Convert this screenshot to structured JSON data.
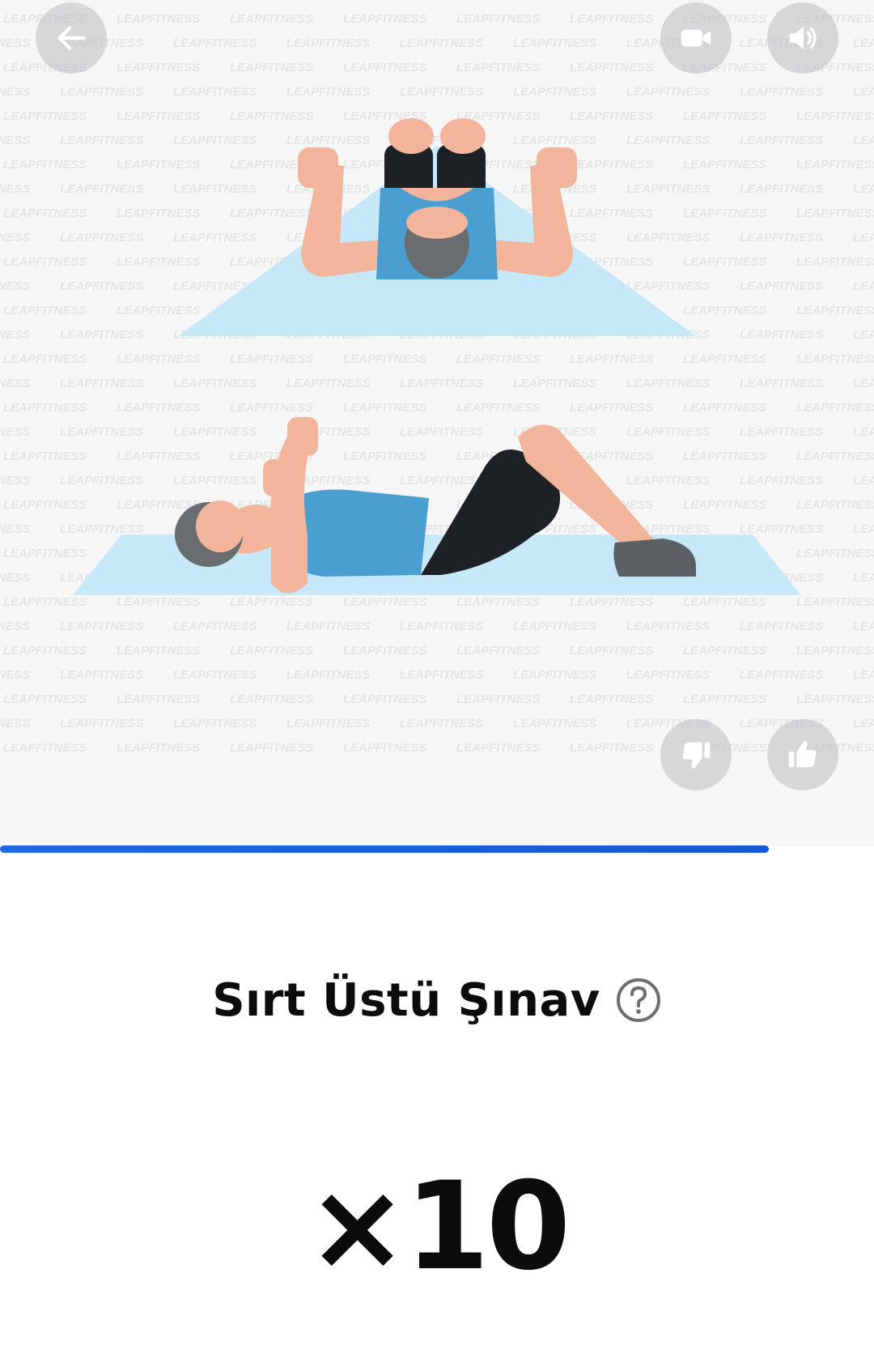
{
  "exercise": {
    "title": "Sırt Üstü Şınav",
    "reps": "×10"
  },
  "watermark": "LEAPFITNESS",
  "progress": {
    "value": 0.88,
    "color": "#1a5fe0"
  },
  "icons": {
    "back": "arrow-left-icon",
    "video": "video-camera-icon",
    "sound": "speaker-icon",
    "dislike": "thumbs-down-icon",
    "like": "thumbs-up-icon",
    "help": "question-circle-icon"
  },
  "colors": {
    "mat": "#c6e8f8",
    "shirt": "#4a9fd0",
    "shorts": "#1d2125",
    "skin": "#f2b49a",
    "hair": "#6a6d70"
  }
}
